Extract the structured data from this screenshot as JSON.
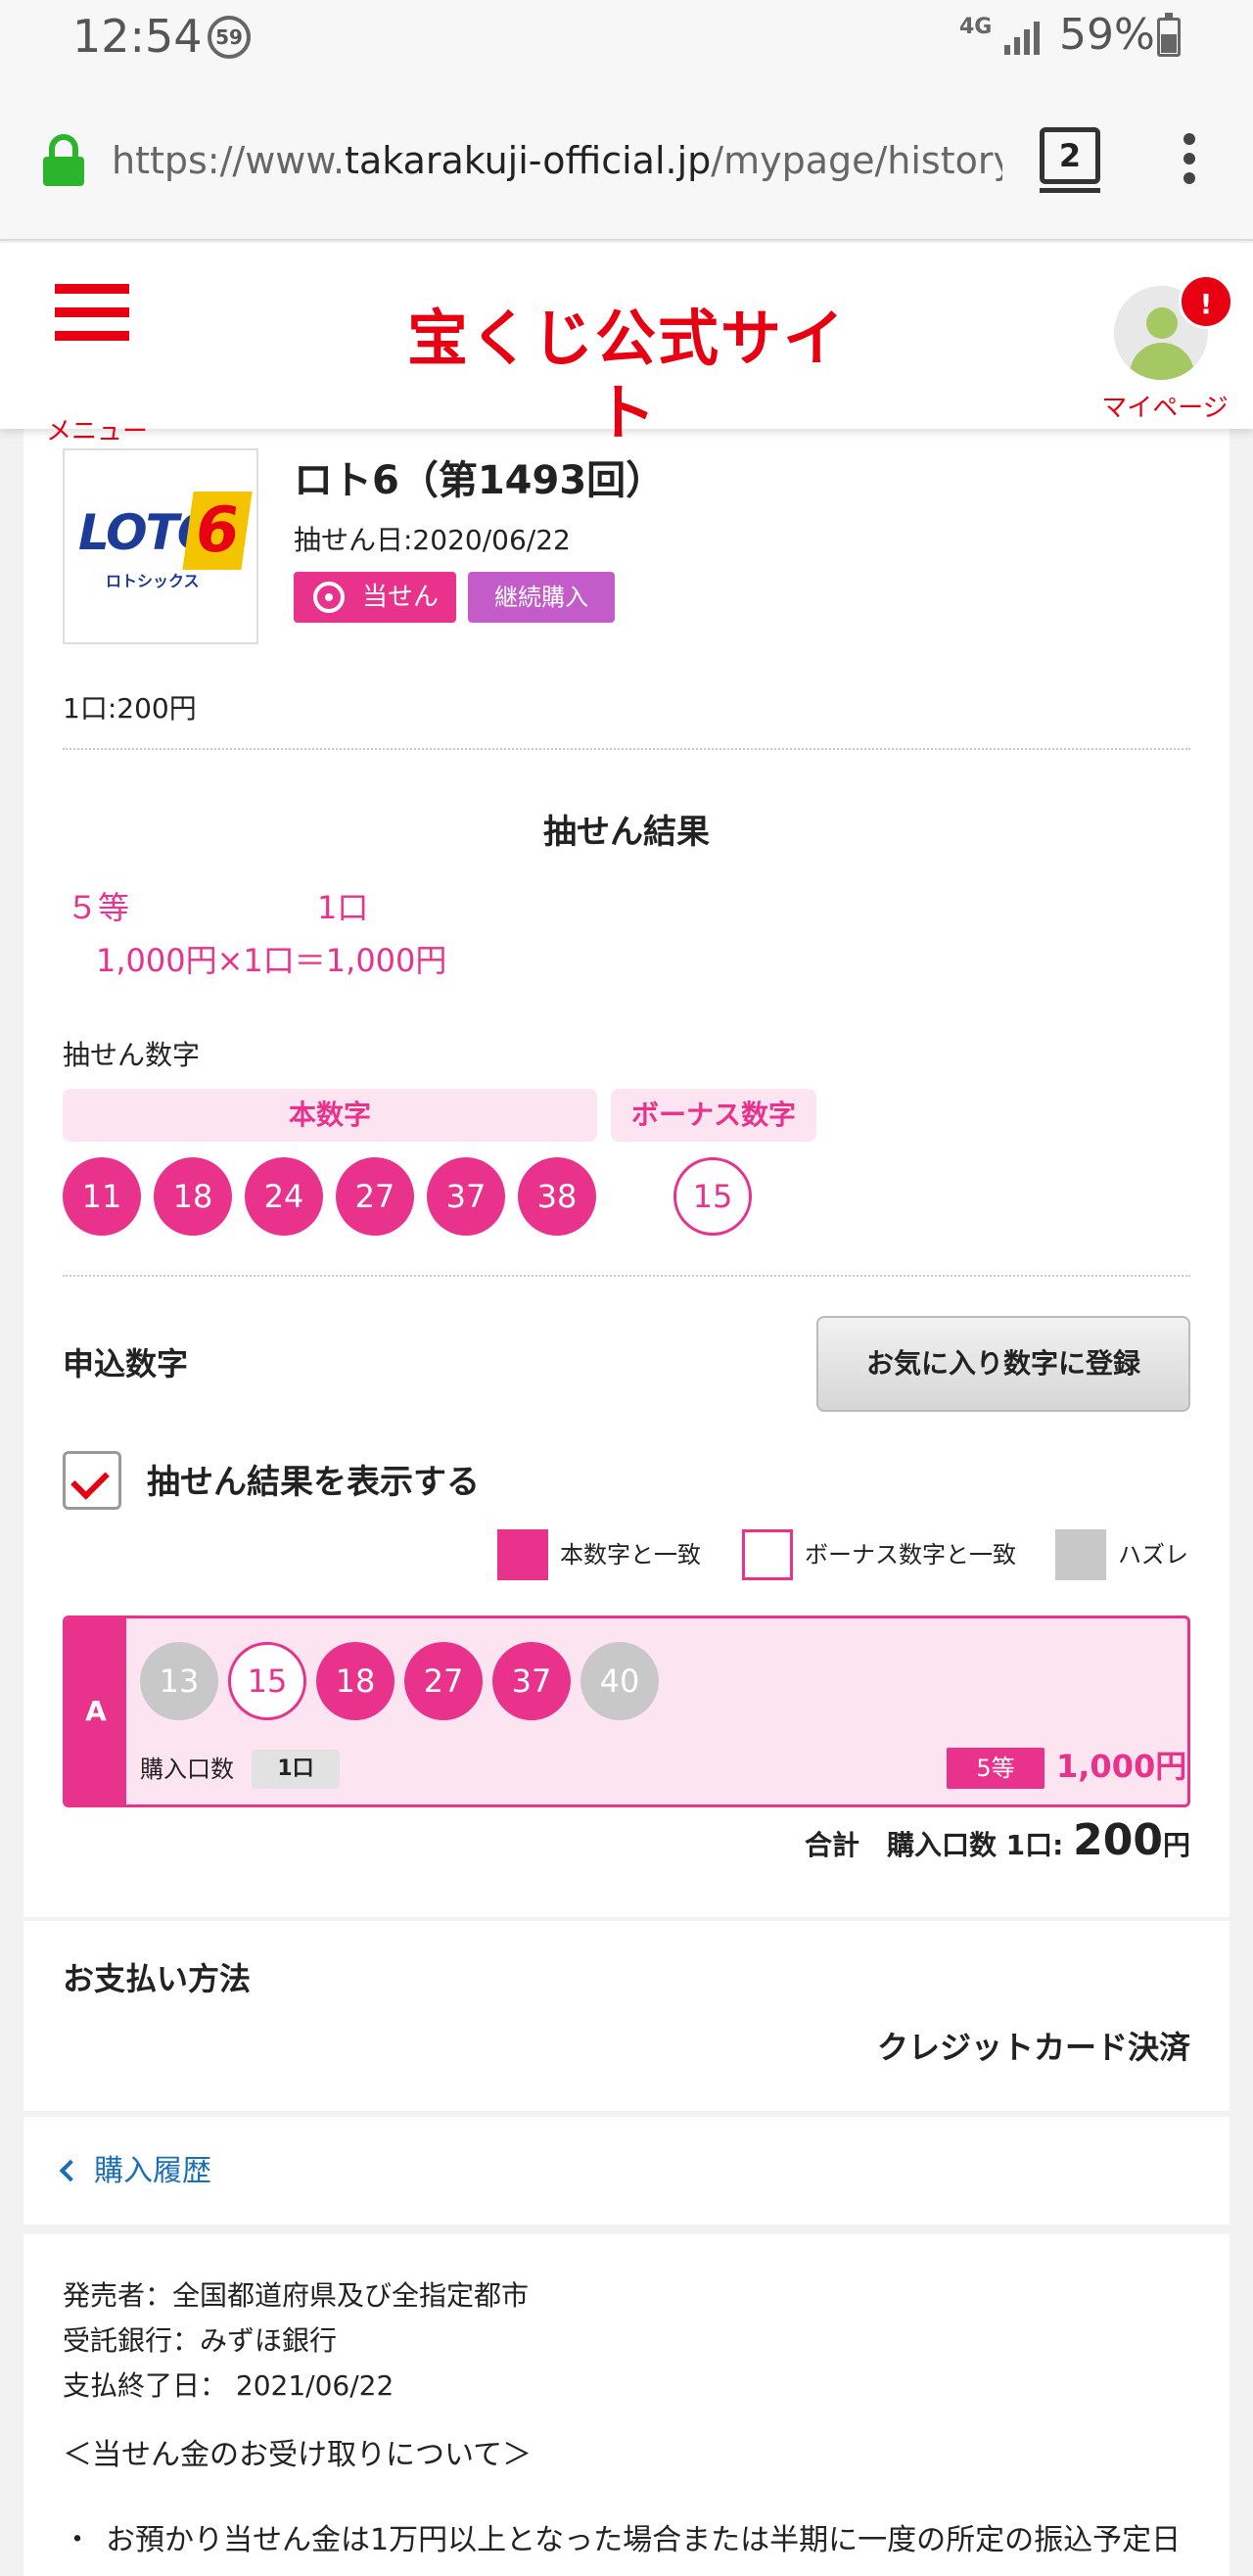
{
  "status_bar": {
    "time": "12:54",
    "notification_count": "59",
    "network": "4G",
    "battery": "59%"
  },
  "browser": {
    "url_scheme": "https://www.",
    "url_host": "takarakuji-official.jp",
    "url_path": "/mypage/history/d",
    "tab_count": "2"
  },
  "header": {
    "menu_label": "メニュー",
    "logo_text": "宝くじ公式サイト",
    "mypage_label": "マイページ",
    "alert": "!"
  },
  "ticket": {
    "logo_text": "LOTO",
    "logo_number": "6",
    "logo_kana": "ロトシックス",
    "title": "ロト6（第1493回）",
    "draw_date": "抽せん日:2020/06/22",
    "badge_win": "当せん",
    "badge_continuous": "継続購入",
    "unit_price": "1口:200円"
  },
  "result": {
    "heading": "抽せん結果",
    "rank": "５等",
    "count": "1口",
    "amount": "1,000円×1口＝1,000円",
    "numbers_label": "抽せん数字",
    "main_label": "本数字",
    "bonus_label": "ボーナス数字",
    "main_numbers": [
      "11",
      "18",
      "24",
      "27",
      "37",
      "38"
    ],
    "bonus_number": "15"
  },
  "application": {
    "label": "申込数字",
    "favorite_button": "お気に入り数字に登録",
    "show_results_label": "抽せん結果を表示する",
    "show_results_checked": true,
    "legend": {
      "match_main": "本数字と一致",
      "match_bonus": "ボーナス数字と一致",
      "miss": "ハズレ"
    },
    "lines": [
      {
        "letter": "A",
        "numbers": [
          {
            "value": "13",
            "status": "miss"
          },
          {
            "value": "15",
            "status": "bonus"
          },
          {
            "value": "18",
            "status": "hit"
          },
          {
            "value": "27",
            "status": "hit"
          },
          {
            "value": "37",
            "status": "hit"
          },
          {
            "value": "40",
            "status": "miss"
          }
        ],
        "qty_label": "購入口数",
        "qty_value": "1口",
        "rank": "5等",
        "amount": "1,000円"
      }
    ],
    "total_prefix": "合計　購入口数 1口: ",
    "total_amount": "200",
    "total_unit": "円"
  },
  "payment": {
    "label": "お支払い方法",
    "method": "クレジットカード決済"
  },
  "navigation": {
    "back_label": "購入履歴"
  },
  "footer": {
    "seller": "発売者：全国都道府県及び全指定都市",
    "bank": "受託銀行：みずほ銀行",
    "payment_end": "支払終了日： 2021/06/22",
    "note_title": "＜当せん金のお受け取りについて＞",
    "bullet": "お預かり当せん金は1万円以上となった場合または半期に一度の所定の振込予定日"
  },
  "colors": {
    "brand_red": "#e60012",
    "pink": "#e8328c",
    "pink_light": "#fde4f1",
    "purple": "#c35cc9",
    "link_blue": "#1a6fb5",
    "miss_gray": "#c8c8c8"
  }
}
